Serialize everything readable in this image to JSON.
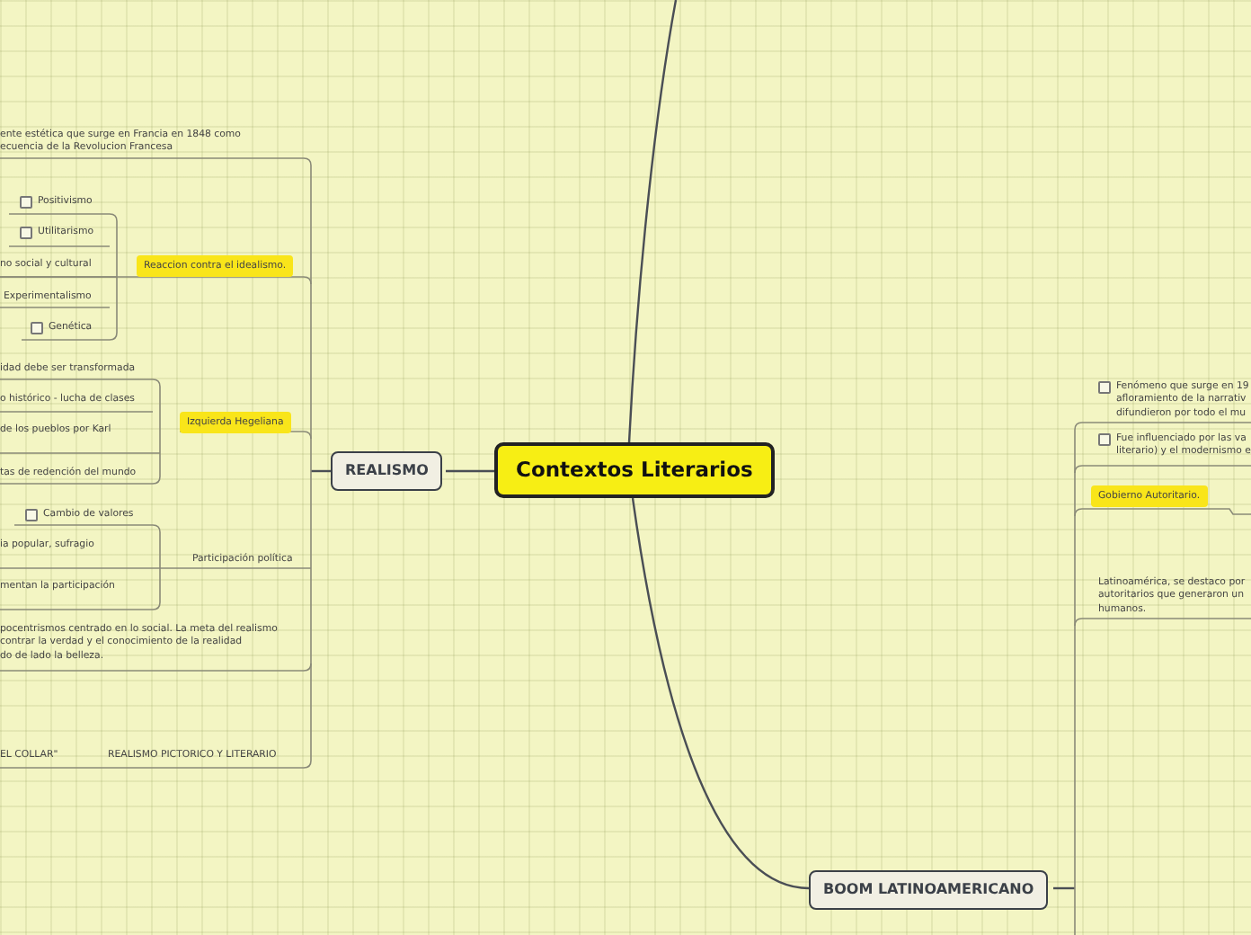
{
  "central_topic": {
    "label": "Contextos Literarios"
  },
  "branches": [
    {
      "label": "REALISMO",
      "items": [
        {
          "kind": "text",
          "lines": [
            "ente estética que surge en Francia en 1848 como",
            "ecuencia de la Revolucion Francesa"
          ]
        },
        {
          "kind": "checkbox",
          "checked": false,
          "lines": [
            "Positivismo"
          ]
        },
        {
          "kind": "checkbox",
          "checked": false,
          "lines": [
            "Utilitarismo"
          ]
        },
        {
          "kind": "text",
          "lines": [
            "no social y cultural"
          ]
        },
        {
          "kind": "topic",
          "highlighted": true,
          "lines": [
            "Reaccion contra el idealismo."
          ]
        },
        {
          "kind": "text",
          "lines": [
            "Experimentalismo"
          ]
        },
        {
          "kind": "checkbox",
          "checked": false,
          "lines": [
            "Genética"
          ]
        },
        {
          "kind": "text",
          "lines": [
            "idad debe ser transformada"
          ]
        },
        {
          "kind": "text",
          "lines": [
            "o histórico - lucha de clases"
          ]
        },
        {
          "kind": "topic",
          "highlighted": true,
          "lines": [
            "Izquierda Hegeliana"
          ]
        },
        {
          "kind": "text",
          "lines": [
            "de los pueblos por Karl"
          ]
        },
        {
          "kind": "text",
          "lines": [
            "tas de redención del mundo"
          ]
        },
        {
          "kind": "checkbox",
          "checked": false,
          "lines": [
            "Cambio de valores"
          ]
        },
        {
          "kind": "text",
          "lines": [
            "ia popular, sufragio"
          ]
        },
        {
          "kind": "topic",
          "highlighted": false,
          "lines": [
            "Participación política"
          ]
        },
        {
          "kind": "text",
          "lines": [
            "mentan la participación"
          ]
        },
        {
          "kind": "text",
          "lines": [
            "pocentrismos centrado en lo social. La meta del realismo",
            "contrar la verdad y el conocimiento de la realidad",
            "do de lado la belleza."
          ]
        },
        {
          "kind": "text",
          "lines": [
            "EL COLLAR\""
          ]
        },
        {
          "kind": "text",
          "lines": [
            "REALISMO PICTORICO Y LITERARIO"
          ]
        }
      ]
    },
    {
      "label": "BOOM LATINOAMERICANO",
      "items": [
        {
          "kind": "checkbox",
          "checked": false,
          "lines": [
            "Fenómeno que surge en 19",
            "afloramiento  de la narrativ",
            "difundieron por todo el mu"
          ]
        },
        {
          "kind": "checkbox",
          "checked": false,
          "lines": [
            "Fue influenciado por las va",
            "literario) y el modernismo e"
          ]
        },
        {
          "kind": "topic",
          "highlighted": true,
          "lines": [
            "Gobierno Autoritario."
          ]
        },
        {
          "kind": "text",
          "lines": [
            "Latinoamérica, se destaco por",
            "autoritarios que generaron un",
            "humanos."
          ]
        }
      ]
    }
  ]
}
